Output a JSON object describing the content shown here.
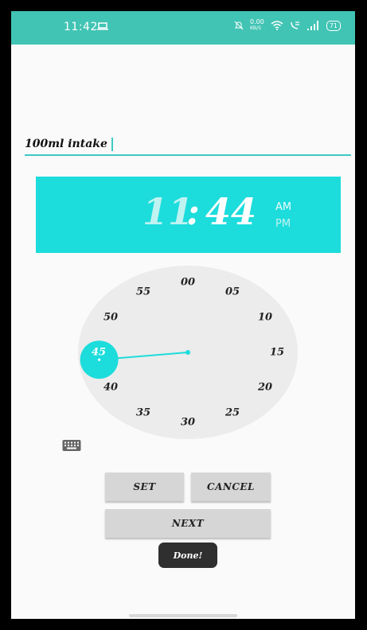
{
  "status_bar": {
    "time": "11:42",
    "net_speed_top": "0.00",
    "net_speed_bottom": "KB/S",
    "battery": "71"
  },
  "alarm_label": {
    "value": "100ml intake"
  },
  "time_header": {
    "hour": "11",
    "separator": ":",
    "minute": "44",
    "am": "AM",
    "pm": "PM",
    "selected_period": "AM"
  },
  "clock": {
    "ticks": [
      "00",
      "05",
      "10",
      "15",
      "20",
      "25",
      "30",
      "35",
      "40",
      "45",
      "50",
      "55"
    ],
    "selected_minute": 44,
    "selected_tick_label": "45"
  },
  "buttons": {
    "set": "SET",
    "cancel": "CANCEL",
    "next": "NEXT"
  },
  "toast": {
    "text": "Done!"
  },
  "colors": {
    "status_bar": "#41c4b4",
    "accent": "#1ddcdc",
    "underline": "#3ec9c3",
    "clock_face": "#ececec",
    "button": "#d6d6d6",
    "toast": "#2f2f2f"
  },
  "icons": {
    "status_left": "laptop-icon",
    "status_right": [
      "silent-icon",
      "wifi-icon",
      "volte-icon",
      "signal-icon",
      "battery-icon"
    ],
    "keyboard_toggle": "keyboard-icon"
  }
}
